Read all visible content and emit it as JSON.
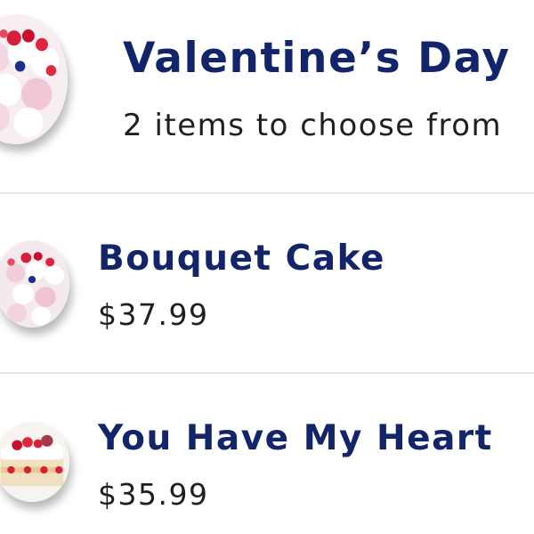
{
  "category": {
    "title": "Valentine’s Day",
    "subtitle": "2 items to choose from",
    "image_icon": "cake-photo-icon"
  },
  "items": [
    {
      "name": "Bouquet Cake",
      "price": "$37.99",
      "image_icon": "bouquet-cake-photo-icon"
    },
    {
      "name": "You Have My Heart",
      "price": "$35.99",
      "image_icon": "heart-cake-photo-icon"
    }
  ],
  "colors": {
    "title": "#12246a",
    "text": "#1f1f1f",
    "divider": "#e4e4e4",
    "background": "#ffffff"
  }
}
